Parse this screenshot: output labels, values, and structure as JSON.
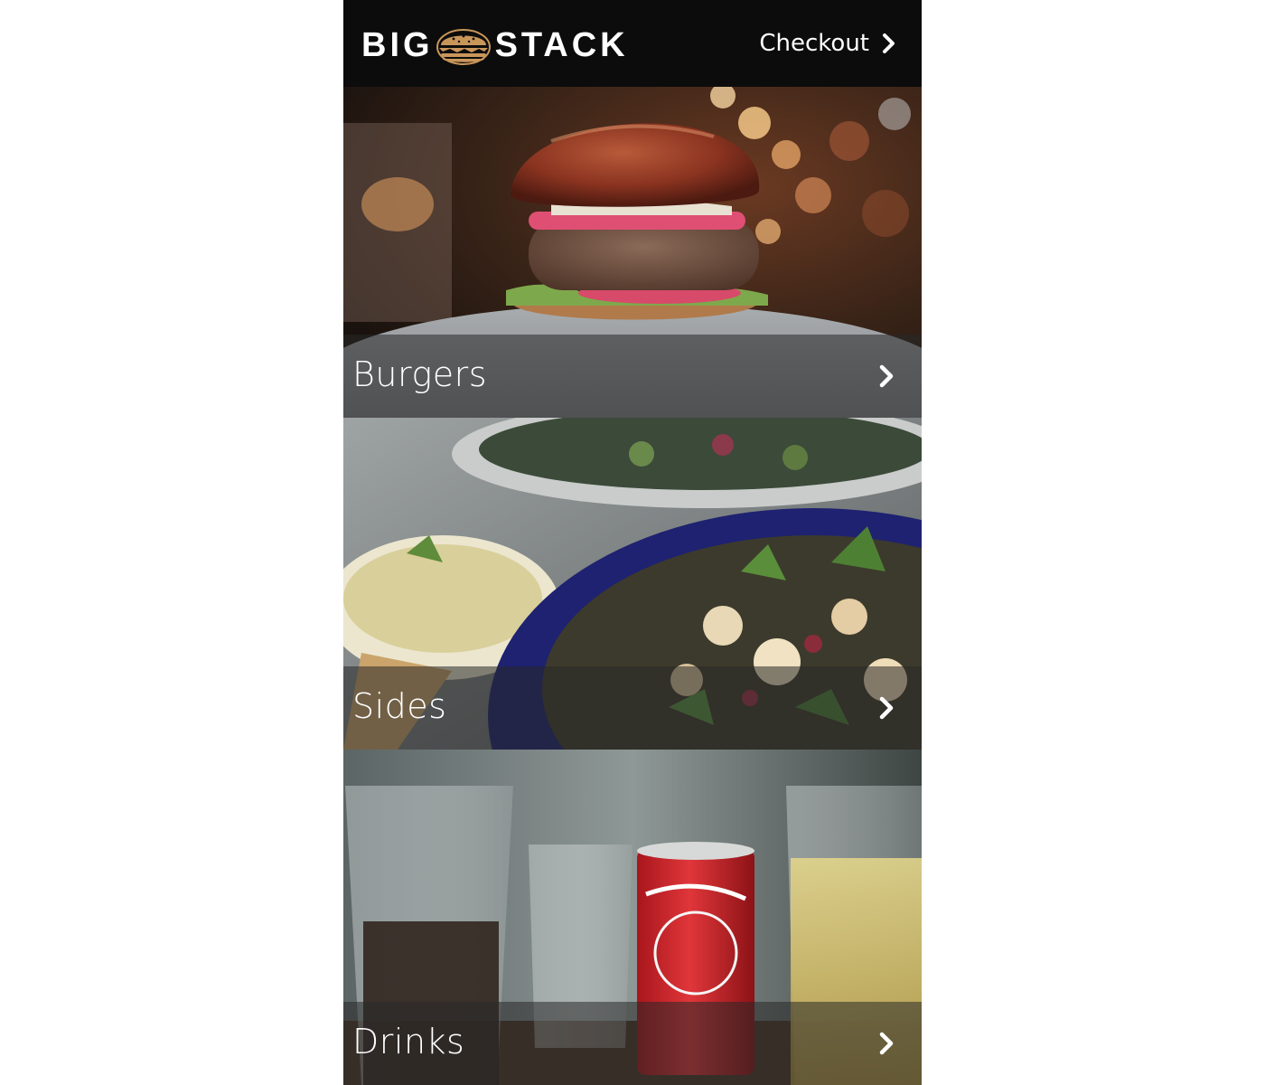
{
  "header": {
    "logo_left": "BIG",
    "logo_right": "STACK",
    "logo_icon": "burger-icon",
    "checkout_label": "Checkout",
    "checkout_icon": "chevron-right-icon"
  },
  "categories": [
    {
      "label": "Burgers",
      "icon": "chevron-right-icon",
      "image": "burger-photo"
    },
    {
      "label": "Sides",
      "icon": "chevron-right-icon",
      "image": "salad-photo"
    },
    {
      "label": "Drinks",
      "icon": "chevron-right-icon",
      "image": "drinks-photo"
    }
  ],
  "colors": {
    "header_bg": "#0c0c0c",
    "logo_accent": "#c9965a",
    "label_bar": "rgba(40,40,40,0.55)",
    "text": "#ffffff"
  }
}
